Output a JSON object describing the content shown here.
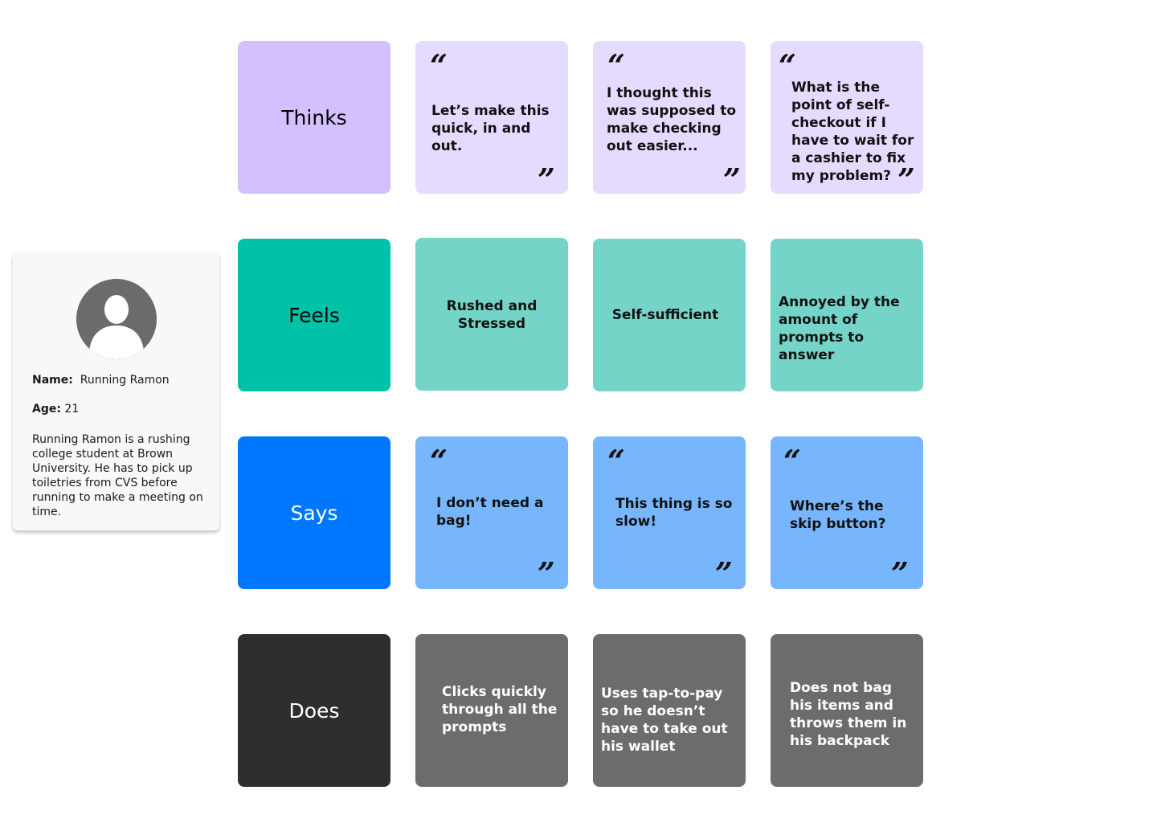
{
  "persona": {
    "name_label": "Name:",
    "name": "Running Ramon",
    "age_label": "Age:",
    "age": "21",
    "bio": "Running Ramon is a rushing college student at Brown University. He has to pick up toiletries from CVS before running to make a meeting on time.",
    "avatar_icon": "user-silhouette-icon"
  },
  "rows": {
    "thinks": {
      "label": "Thinks",
      "items": [
        "Let’s make this quick, in and out.",
        "I thought this was supposed to make checking out easier...",
        "What is the point of self-checkout if I have to wait for a cashier to fix my problem?"
      ]
    },
    "feels": {
      "label": "Feels",
      "items": [
        "Rushed and Stressed",
        "Self-sufficient",
        "Annoyed by the amount of prompts to answer"
      ]
    },
    "says": {
      "label": "Says",
      "items": [
        "I don’t need a bag!",
        "This thing is so slow!",
        "Where’s the skip button?"
      ]
    },
    "does": {
      "label": "Does",
      "items": [
        "Clicks quickly through all the prompts",
        "Uses tap-to-pay so he doesn’t have to take out his wallet",
        "Does not bag his items and throws them in his backpack"
      ]
    }
  },
  "quote_open": "“",
  "quote_close": "”",
  "colors": {
    "thinks_main": "#d3c0ff",
    "thinks": "#e5dbff",
    "feels_main": "#00c2a8",
    "feels": "#74d4c7",
    "says_main": "#0077ff",
    "says": "#77b6fd",
    "does_main": "#2e2e2e",
    "does": "#6c6c6c"
  }
}
